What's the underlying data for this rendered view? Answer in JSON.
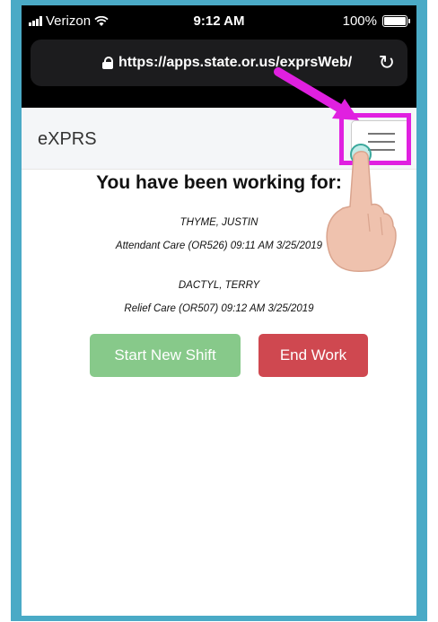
{
  "status_bar": {
    "carrier": "Verizon",
    "time": "9:12 AM",
    "battery": "100%"
  },
  "browser": {
    "url": "https://apps.state.or.us/exprsWeb/"
  },
  "navbar": {
    "brand": "eXPRS"
  },
  "main": {
    "heading": "You have been working for:",
    "workers": [
      {
        "name": "THYME, JUSTIN",
        "detail": "Attendant Care (OR526)  09:11 AM 3/25/2019"
      },
      {
        "name": "DACTYL, TERRY",
        "detail": "Relief Care (OR507)  09:12 AM 3/25/2019"
      }
    ],
    "start_shift_label": "Start New Shift",
    "end_work_label": "End Work"
  },
  "colors": {
    "frame": "#4aaac6",
    "highlight": "#e020e0",
    "start_button": "#87c98a",
    "end_button": "#cf4850"
  }
}
